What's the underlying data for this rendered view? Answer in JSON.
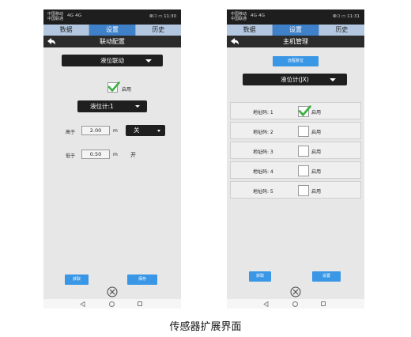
{
  "screen_left": {
    "status": {
      "carrier1": "中国移动",
      "carrier2": "中国联通",
      "signal": "4G 4G",
      "time": "⦾❍ ▭ 11:30"
    },
    "tabs": [
      "数据",
      "设置",
      "历史"
    ],
    "active_tab": "设置",
    "title": "联动配置",
    "mode_select": "液位联动",
    "enable_label": "启用",
    "enable_checked": true,
    "gauge_select": "液位计:1",
    "high": {
      "label": "高于",
      "value": "2.00",
      "unit": "m",
      "action": "关"
    },
    "low": {
      "label": "低于",
      "value": "0.50",
      "unit": "m",
      "action": "开"
    },
    "buttons": {
      "fetch": "获取",
      "save": "保存"
    }
  },
  "screen_right": {
    "status": {
      "carrier1": "中国移动",
      "carrier2": "中国联通",
      "signal": "4G 4G",
      "time": "⦾❍ ▭ 11:31"
    },
    "tabs": [
      "数据",
      "设置",
      "历史"
    ],
    "active_tab": "设置",
    "title": "主机管理",
    "reset_button": "远程复位",
    "device_select": "液位计(JX)",
    "address_rows": [
      {
        "label": "地址码: 1",
        "enable": "启用",
        "checked": true
      },
      {
        "label": "地址码: 2",
        "enable": "启用",
        "checked": false
      },
      {
        "label": "地址码: 3",
        "enable": "启用",
        "checked": false
      },
      {
        "label": "地址码: 4",
        "enable": "启用",
        "checked": false
      },
      {
        "label": "地址码: 5",
        "enable": "启用",
        "checked": false
      }
    ],
    "buttons": {
      "fetch": "获取",
      "set": "设置"
    }
  },
  "caption": "传感器扩展界面",
  "colors": {
    "active_tab": "#3f81c9",
    "button": "#3a97e6",
    "check": "#3cb043",
    "titlebar": "#2b2b2b"
  }
}
